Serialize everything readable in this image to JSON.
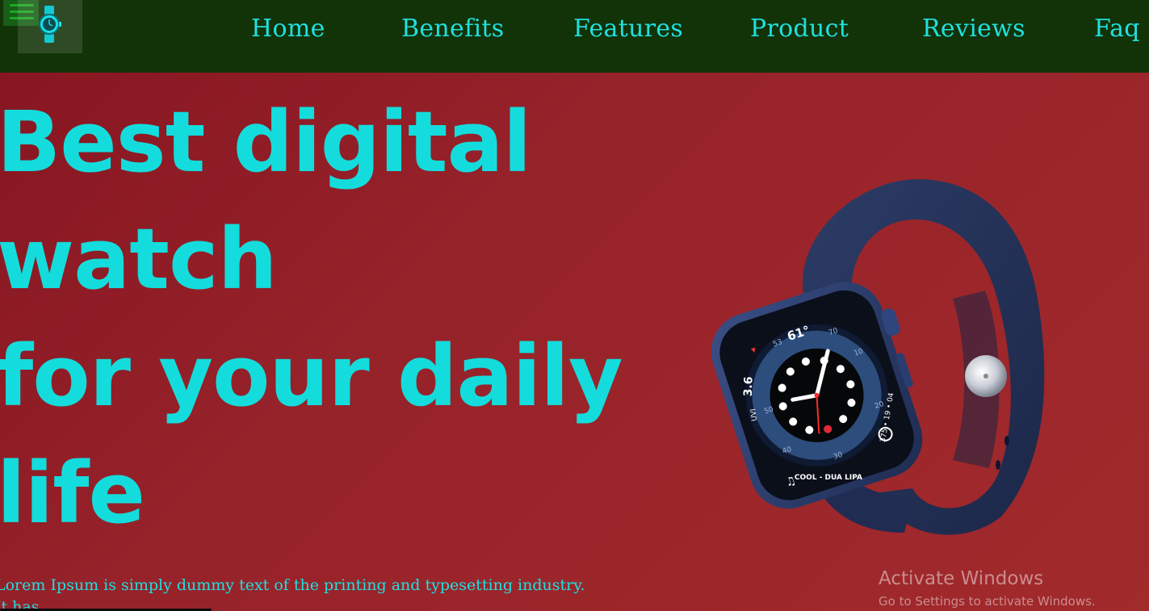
{
  "navbar": {
    "menu_icon": "hamburger-menu-icon",
    "logo_icon": "wristwatch-icon",
    "links": [
      {
        "label": "Home"
      },
      {
        "label": "Benefits"
      },
      {
        "label": "Features"
      },
      {
        "label": "Product"
      },
      {
        "label": "Reviews"
      },
      {
        "label": "Faq"
      }
    ]
  },
  "hero": {
    "title_lines": [
      "Best digital",
      "watch",
      "for your daily",
      "life"
    ],
    "description": "Lorem Ipsum is simply dummy text of the printing and typesetting industry. It has",
    "image": {
      "icon": "smartwatch-image",
      "face": {
        "temperature": "61°",
        "left_complication": "3.6",
        "left_sub": "UVI",
        "bottom_text": "COOL - DUA LIPA",
        "right_text": "375 • 19 • 04",
        "ticks": [
          "50",
          "53",
          "70",
          "10",
          "20",
          "30",
          "40"
        ]
      }
    }
  },
  "watermark": {
    "title": "Activate Windows",
    "subtitle": "Go to Settings to activate Windows."
  },
  "colors": {
    "nav_bg": "#123307",
    "hero_bg": "#8d1c20",
    "accent": "#14dcdc",
    "strap": "#25345a"
  }
}
